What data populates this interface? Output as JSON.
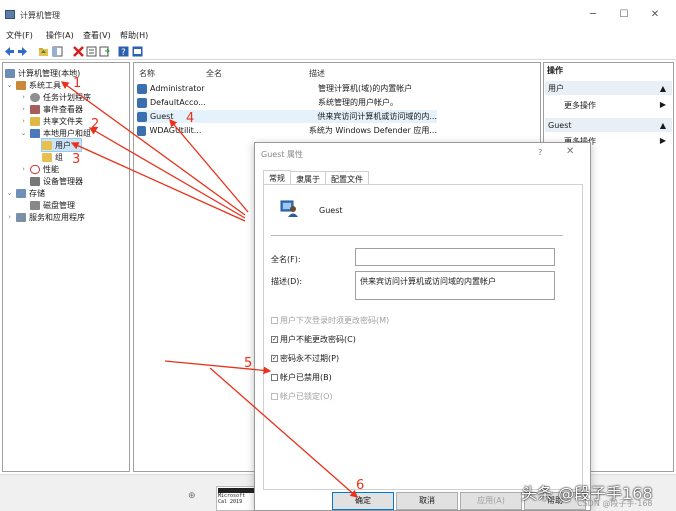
{
  "window": {
    "title": "计算机管理",
    "controls": [
      "─",
      "☐",
      "✕"
    ]
  },
  "menu": [
    "文件(F)",
    "操作(A)",
    "查看(V)",
    "帮助(H)"
  ],
  "tree": {
    "root": "计算机管理(本地)",
    "system_tools": "系统工具",
    "task_scheduler": "任务计划程序",
    "event_viewer": "事件查看器",
    "shared_folders": "共享文件夹",
    "local_users_groups": "本地用户和组",
    "users": "用户",
    "groups": "组",
    "performance": "性能",
    "device_manager": "设备管理器",
    "storage": "存储",
    "disk_management": "磁盘管理",
    "services_apps": "服务和应用程序"
  },
  "list": {
    "headers": {
      "name": "名称",
      "fullname": "全名",
      "desc": "描述"
    },
    "rows": [
      {
        "name": "Administrator",
        "desc": "管理计算机(域)的内置帐户"
      },
      {
        "name": "DefaultAcco...",
        "desc": "系统管理的用户帐户。"
      },
      {
        "name": "Guest",
        "desc": "供来宾访问计算机或访问域的内..."
      },
      {
        "name": "WDAGUtilit...",
        "desc": "系统为 Windows Defender 应用..."
      }
    ]
  },
  "actions": {
    "header": "操作",
    "section1": "用户",
    "more1": "更多操作",
    "section2": "Guest",
    "more2": "更多操作"
  },
  "dialog": {
    "title": "Guest 属性",
    "help": "?",
    "close": "✕",
    "tabs": [
      "常规",
      "隶属于",
      "配置文件"
    ],
    "username": "Guest",
    "fullname_label": "全名(F):",
    "fullname_value": "",
    "desc_label": "描述(D):",
    "desc_value": "供来宾访问计算机或访问域的内置帐户",
    "chk_must_change": "用户下次登录时须更改密码(M)",
    "chk_cannot_change": "用户不能更改密码(C)",
    "chk_never_expires": "密码永不过期(P)",
    "chk_disabled": "帐户已禁用(B)",
    "chk_locked": "帐户已锁定(O)",
    "btn_ok": "确定",
    "btn_cancel": "取消",
    "btn_apply": "应用(A)",
    "btn_help": "帮助"
  },
  "annotations": [
    "1",
    "2",
    "3",
    "4",
    "5",
    "6"
  ],
  "terminal_text": "Microsoft\nCal 2019",
  "watermark": "头条 @段子手168",
  "watermark2": "CSDN @段子手-168",
  "colors": {
    "arrow": "#e8321a",
    "selection": "#cce4f7"
  }
}
